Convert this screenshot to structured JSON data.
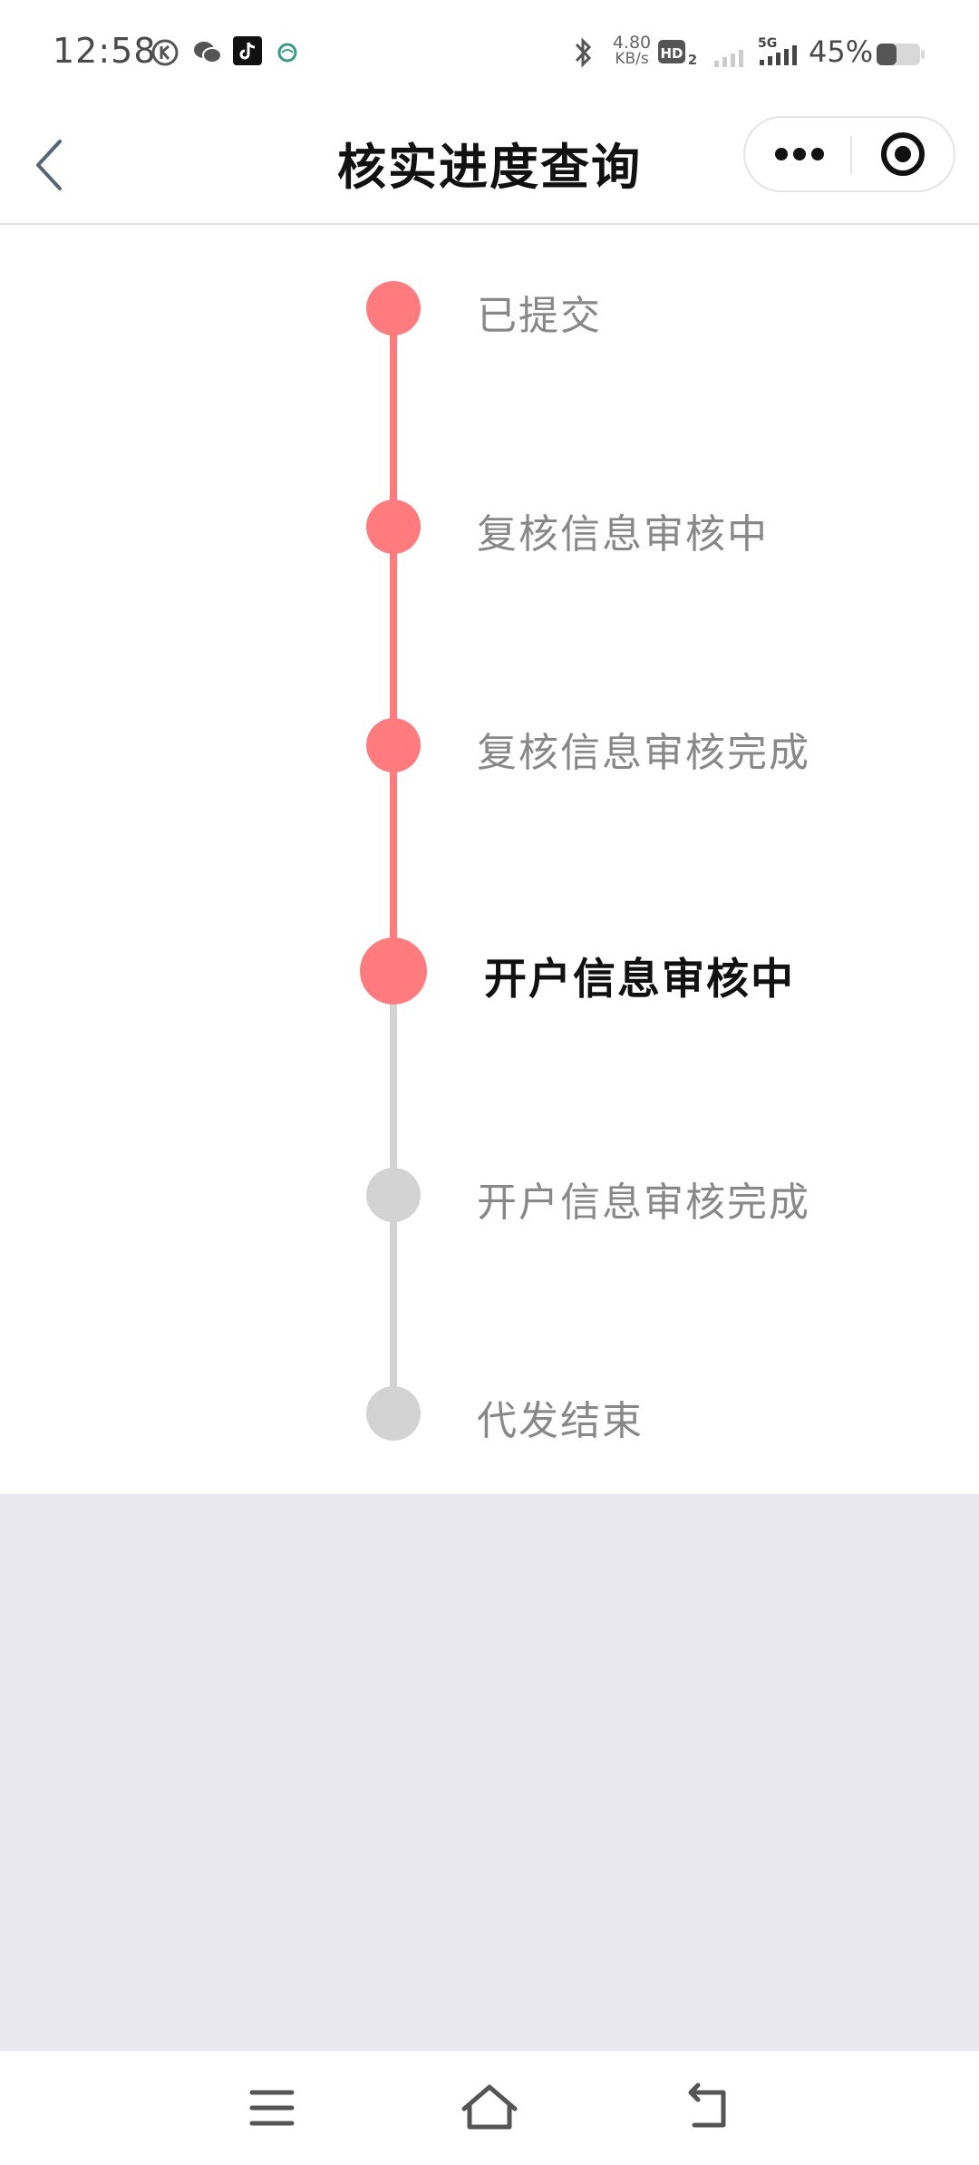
{
  "status_bar": {
    "time": "12:58",
    "net_speed_value": "4.80",
    "net_speed_unit": "KB/s",
    "battery": "45%",
    "icons": [
      "k-app-icon",
      "wechat-icon",
      "tiktok-icon",
      "china-mobile-icon",
      "bluetooth-icon",
      "hd-icon",
      "signal-icon",
      "5g-signal-icon",
      "battery-icon"
    ]
  },
  "nav": {
    "title": "核实进度查询",
    "back_icon": "chevron-left-icon",
    "more_icon": "more-dots-icon",
    "close_icon": "target-close-icon"
  },
  "timeline": {
    "current_index": 3,
    "colors": {
      "done": "#ff7b7e",
      "pending": "#d3d3d3",
      "label_done": "#888888",
      "label_active": "#111111"
    },
    "steps": [
      {
        "label": "已提交",
        "state": "done"
      },
      {
        "label": "复核信息审核中",
        "state": "done"
      },
      {
        "label": "复核信息审核完成",
        "state": "done"
      },
      {
        "label": "开户信息审核中",
        "state": "active"
      },
      {
        "label": "开户信息审核完成",
        "state": "pending"
      },
      {
        "label": "代发结束",
        "state": "pending"
      }
    ]
  },
  "system_nav": {
    "icons": [
      "menu-icon",
      "home-icon",
      "back-arrow-icon"
    ]
  }
}
